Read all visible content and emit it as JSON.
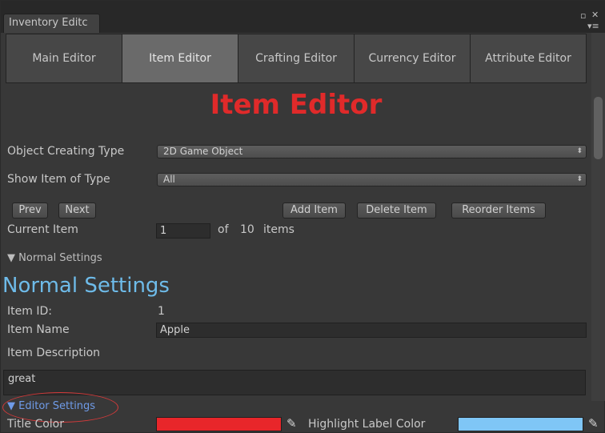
{
  "window": {
    "tab_title": "Inventory Editc",
    "controls": [
      "▫",
      "✕"
    ],
    "menu_glyph": "▾≡"
  },
  "tabs": [
    {
      "label": "Main Editor",
      "active": false
    },
    {
      "label": "Item Editor",
      "active": true
    },
    {
      "label": "Crafting Editor",
      "active": false
    },
    {
      "label": "Currency Editor",
      "active": false
    },
    {
      "label": "Attribute Editor",
      "active": false
    }
  ],
  "header": {
    "title": "Item Editor",
    "title_color": "#e02a2a"
  },
  "object_type": {
    "label": "Object Creating Type",
    "value": "2D Game Object"
  },
  "show_type": {
    "label": "Show Item of Type",
    "value": "All"
  },
  "nav": {
    "prev": "Prev",
    "next": "Next",
    "add": "Add Item",
    "delete": "Delete Item",
    "reorder": "Reorder Items"
  },
  "current_item": {
    "label": "Current Item",
    "value": "1",
    "of": "of",
    "total": "10",
    "suffix": "items"
  },
  "normal_settings": {
    "foldout": "Normal Settings",
    "heading": "Normal Settings",
    "heading_color": "#6ebbe9",
    "item_id_label": "Item ID:",
    "item_id": "1",
    "item_name_label": "Item Name",
    "item_name": "Apple",
    "desc_label": "Item Description",
    "desc": "great"
  },
  "editor_settings": {
    "foldout": "Editor Settings",
    "title_color_label": "Title Color",
    "title_color": "#e8262a",
    "highlight_label": "Highlight Label Color",
    "highlight_color": "#7fc6f6"
  }
}
